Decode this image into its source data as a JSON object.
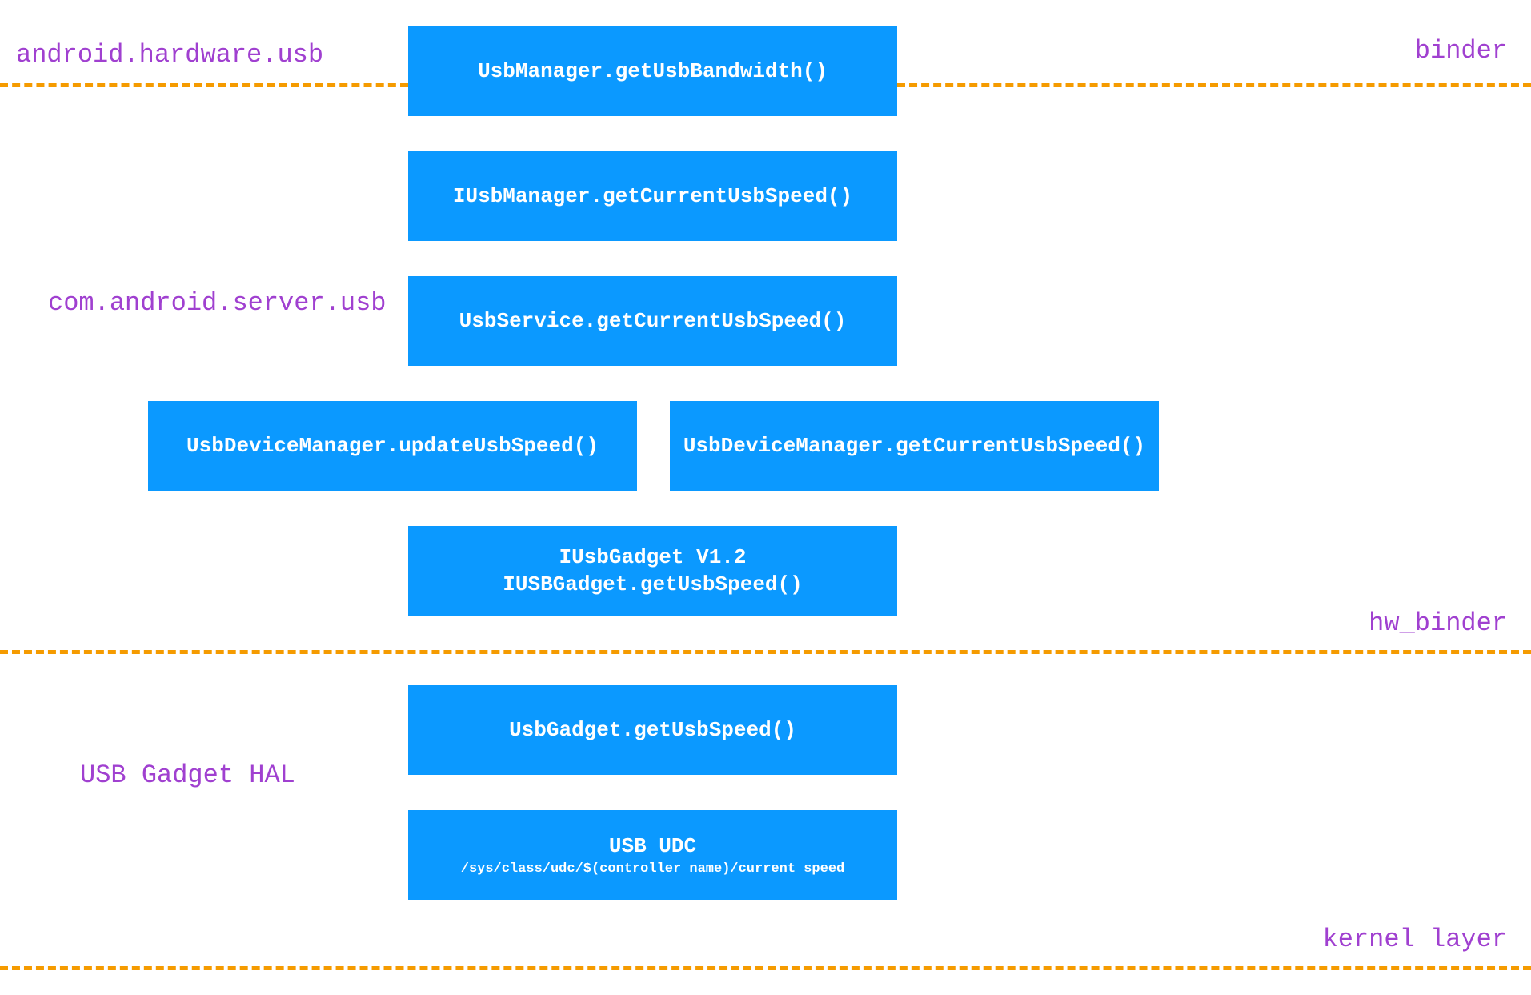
{
  "labels": {
    "l1": "android.hardware.usb",
    "l2": "binder",
    "l3": "com.android.server.usb",
    "l4": "hw_binder",
    "l5": "USB Gadget HAL",
    "l6": "kernel layer"
  },
  "boxes": {
    "b1": "UsbManager.getUsbBandwidth()",
    "b2": "IUsbManager.getCurrentUsbSpeed()",
    "b3": "UsbService.getCurrentUsbSpeed()",
    "b4": "UsbDeviceManager.updateUsbSpeed()",
    "b5": "UsbDeviceManager.getCurrentUsbSpeed()",
    "b6a": "IUsbGadget V1.2",
    "b6b": "IUSBGadget.getUsbSpeed()",
    "b7": "UsbGadget.getUsbSpeed()",
    "b8a": "USB UDC",
    "b8b": "/sys/class/udc/$(controller_name)/current_speed"
  }
}
